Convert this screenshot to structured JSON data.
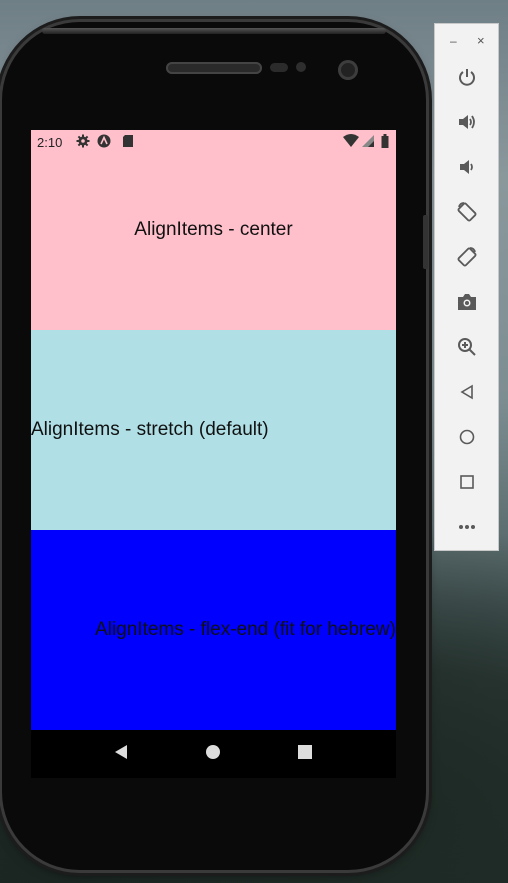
{
  "status_bar": {
    "time": "2:10",
    "left_icons": [
      "gear-icon",
      "a-badge-icon",
      "sd-card-icon"
    ],
    "right_icons": [
      "wifi-icon",
      "signal-icon",
      "battery-icon"
    ]
  },
  "sections": [
    {
      "label": "AlignItems - center",
      "background": "#ffc0cb"
    },
    {
      "label": "AlignItems - stretch (default)",
      "background": "#b0e0e6"
    },
    {
      "label": "AlignItems - flex-end (fit for hebrew)",
      "background": "#0000ff"
    }
  ],
  "nav_bar": [
    "back-icon",
    "home-icon",
    "overview-icon"
  ],
  "emulator_panel": {
    "window_controls": {
      "minimize": "–",
      "close": "×"
    },
    "buttons": [
      "power-icon",
      "volume-up-icon",
      "volume-down-icon",
      "rotate-left-icon",
      "rotate-right-icon",
      "camera-icon",
      "zoom-icon",
      "back-icon",
      "home-icon",
      "overview-icon",
      "more-icon"
    ]
  }
}
